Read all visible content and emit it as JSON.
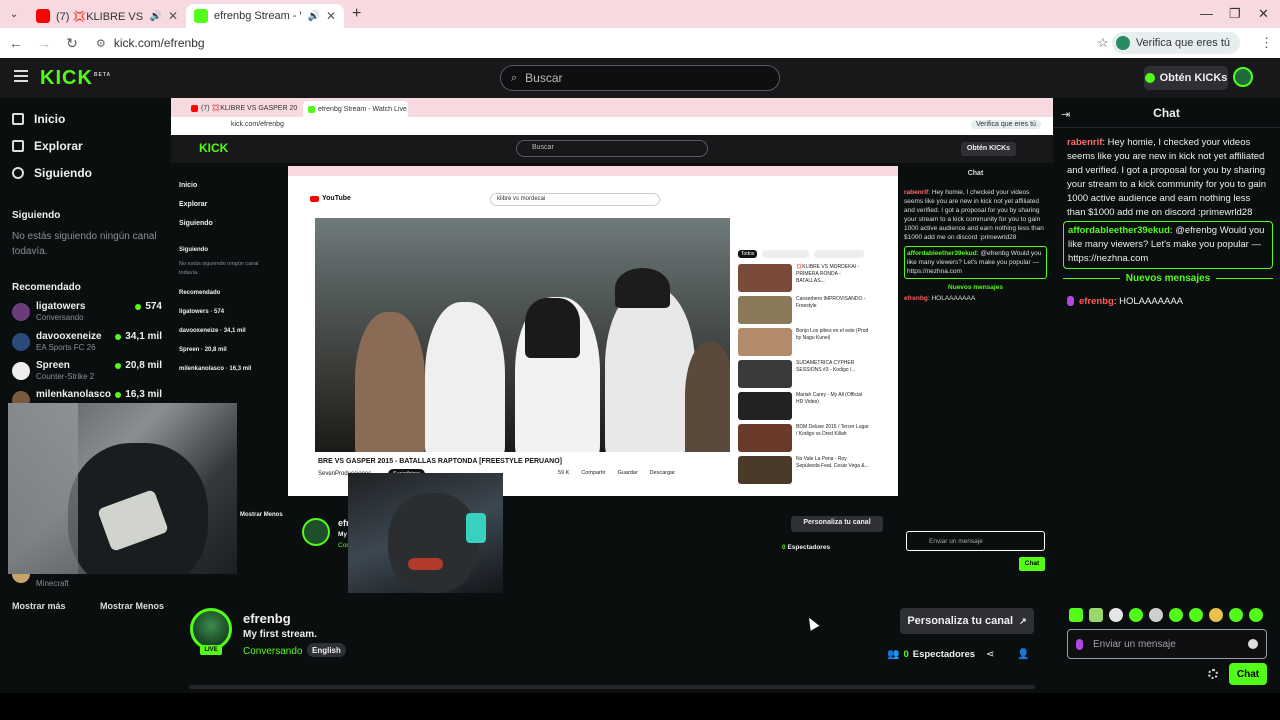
{
  "browser": {
    "tabs": [
      {
        "label": "(7) 💢KLIBRE VS GASPER 20",
        "active": false
      },
      {
        "label": "efrenbg Stream - Watch Live",
        "active": true
      }
    ],
    "url": "kick.com/efrenbg",
    "verify_label": "Verifica que eres tú"
  },
  "topbar": {
    "logo": "KICK",
    "logo_badge": "BETA",
    "search_placeholder": "Buscar",
    "kicks_label": "Obtén KICKs"
  },
  "sidebar": {
    "nav": [
      {
        "label": "Inicio",
        "icon": "home-icon"
      },
      {
        "label": "Explorar",
        "icon": "browse-icon"
      },
      {
        "label": "Siguiendo",
        "icon": "heart-icon"
      }
    ],
    "following_header": "Siguiendo",
    "following_empty": "No estás siguiendo ningún canal todavía.",
    "recommended_header": "Recomendado",
    "recommended": [
      {
        "name": "ligatowers",
        "category": "Conversando",
        "viewers": "574"
      },
      {
        "name": "davooxeneize",
        "category": "EA Sports FC 26",
        "viewers": "34,1 mil"
      },
      {
        "name": "Spreen",
        "category": "Counter-Strike 2",
        "viewers": "20,8 mil"
      },
      {
        "name": "milenkanolasco",
        "category": "",
        "viewers": "16,3 mil"
      }
    ],
    "last_category": "Minecraft",
    "show_more": "Mostrar más",
    "show_less": "Mostrar Menos"
  },
  "inner": {
    "yt_search": "klibre vs mordecai",
    "video_title": "BRE VS GASPER 2015 - BATALLAS RAPTONDA [FREESTYLE PERUANO]",
    "channel": "SevenProducciones",
    "subscribe": "Suscribirse",
    "yt_actions": [
      "59 K",
      "Compartir",
      "Guardar",
      "Descargar"
    ],
    "yt_side_tabs": [
      "Todos",
      "De tus búsquedas",
      "De SevenProduccio"
    ],
    "yt_side": [
      "💢KLIBRE VS MORDEKAI - PRIMERA RONDA - BATALLAS...",
      "Canserbero IMPROVISANDO - Freestyle",
      "Bonjo Los pibes en el este (Prod by Nagu Kunei)",
      "SUDAMETRICA CYPHER SESSIONS #3 - Kodigo /...",
      "Mariah Carey - My All (Official HD Video)",
      "BDM Deluxe 2015 / Tercer Lugar / Kodigo vs Dred Killah",
      "No Vale La Pena - Roy Sepúlveda Feat. Cesar Vega &..."
    ],
    "show_less": "Mostrar Menos"
  },
  "chat": {
    "title": "Chat",
    "messages": [
      {
        "user": "rabenrif",
        "text": "Hey homie, I checked your videos seems like you are new in kick not yet affiliated and verified. I got a proposal for you by sharing your stream to a kick community for you to gain 1000 active audience and earn nothing less than $1000 add me on discord :primewrld28",
        "color": "#ff6b6b"
      },
      {
        "user": "affordableether39ekud",
        "text": "@efrenbg Would you like many viewers? Let's make you popular — https://nezhna.com",
        "color": "#53fc18"
      },
      {
        "user": "efrenbg",
        "text": "HOLAAAAAAA",
        "color": "#ff5a5a"
      }
    ],
    "new_messages": "Nuevos mensajes",
    "input_placeholder": "Enviar un mensaje",
    "send_label": "Chat"
  },
  "stream": {
    "name": "efrenbg",
    "title": "My first stream.",
    "category": "Conversando",
    "language": "English",
    "live_badge": "LIVE",
    "customize": "Personaliza tu canal",
    "viewers_count": "0",
    "viewers_label": "Espectadores"
  }
}
